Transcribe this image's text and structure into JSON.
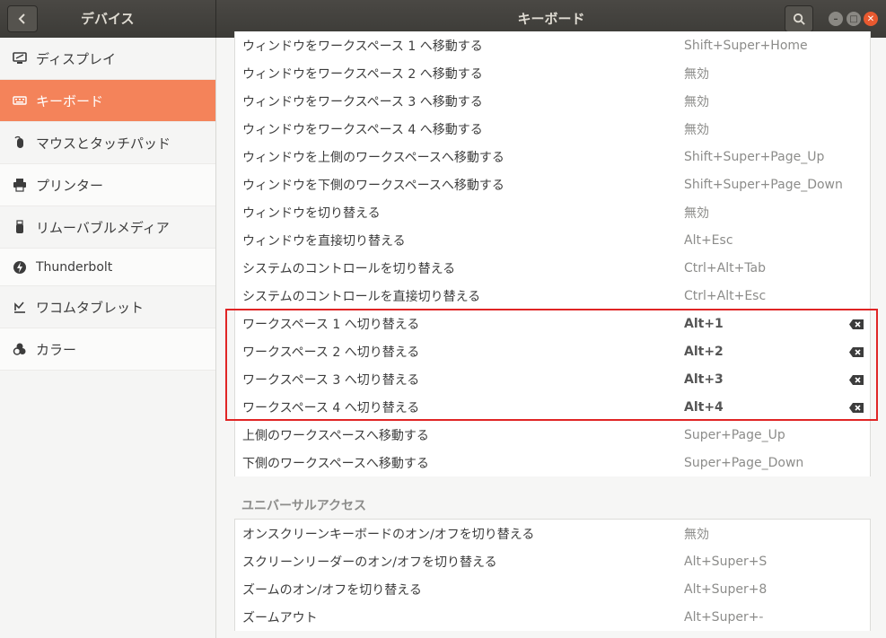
{
  "window": {
    "left_title": "デバイス",
    "center_title": "キーボード"
  },
  "sidebar": {
    "items": [
      {
        "label": "ディスプレイ",
        "icon": "display-icon"
      },
      {
        "label": "キーボード",
        "icon": "keyboard-icon"
      },
      {
        "label": "マウスとタッチパッド",
        "icon": "mouse-icon"
      },
      {
        "label": "プリンター",
        "icon": "printer-icon"
      },
      {
        "label": "リムーバブルメディア",
        "icon": "removable-media-icon"
      },
      {
        "label": "Thunderbolt",
        "icon": "thunderbolt-icon"
      },
      {
        "label": "ワコムタブレット",
        "icon": "tablet-icon"
      },
      {
        "label": "カラー",
        "icon": "color-icon"
      }
    ],
    "active_index": 1
  },
  "shortcuts": [
    {
      "action": "ウィンドウをワークスペース 1 へ移動する",
      "accel": "Shift+Super+Home"
    },
    {
      "action": "ウィンドウをワークスペース 2 へ移動する",
      "accel": "無効"
    },
    {
      "action": "ウィンドウをワークスペース 3 へ移動する",
      "accel": "無効"
    },
    {
      "action": "ウィンドウをワークスペース 4 へ移動する",
      "accel": "無効"
    },
    {
      "action": "ウィンドウを上側のワークスペースへ移動する",
      "accel": "Shift+Super+Page_Up"
    },
    {
      "action": "ウィンドウを下側のワークスペースへ移動する",
      "accel": "Shift+Super+Page_Down"
    },
    {
      "action": "ウィンドウを切り替える",
      "accel": "無効"
    },
    {
      "action": "ウィンドウを直接切り替える",
      "accel": "Alt+Esc"
    },
    {
      "action": "システムのコントロールを切り替える",
      "accel": "Ctrl+Alt+Tab"
    },
    {
      "action": "システムのコントロールを直接切り替える",
      "accel": "Ctrl+Alt+Esc"
    },
    {
      "action": "ワークスペース 1 へ切り替える",
      "accel": "Alt+1"
    },
    {
      "action": "ワークスペース 2 へ切り替える",
      "accel": "Alt+2"
    },
    {
      "action": "ワークスペース 3 へ切り替える",
      "accel": "Alt+3"
    },
    {
      "action": "ワークスペース 4 へ切り替える",
      "accel": "Alt+4"
    },
    {
      "action": "上側のワークスペースへ移動する",
      "accel": "Super+Page_Up"
    },
    {
      "action": "下側のワークスペースへ移動する",
      "accel": "Super+Page_Down"
    }
  ],
  "universal_access": {
    "title": "ユニバーサルアクセス",
    "shortcuts": [
      {
        "action": "オンスクリーンキーボードのオン/オフを切り替える",
        "accel": "無効"
      },
      {
        "action": "スクリーンリーダーのオン/オフを切り替える",
        "accel": "Alt+Super+S"
      },
      {
        "action": "ズームのオン/オフを切り替える",
        "accel": "Alt+Super+8"
      },
      {
        "action": "ズームアウト",
        "accel": "Alt+Super+-"
      }
    ]
  },
  "colors": {
    "accent": "#f4835a",
    "highlight_box": "#e02525"
  }
}
